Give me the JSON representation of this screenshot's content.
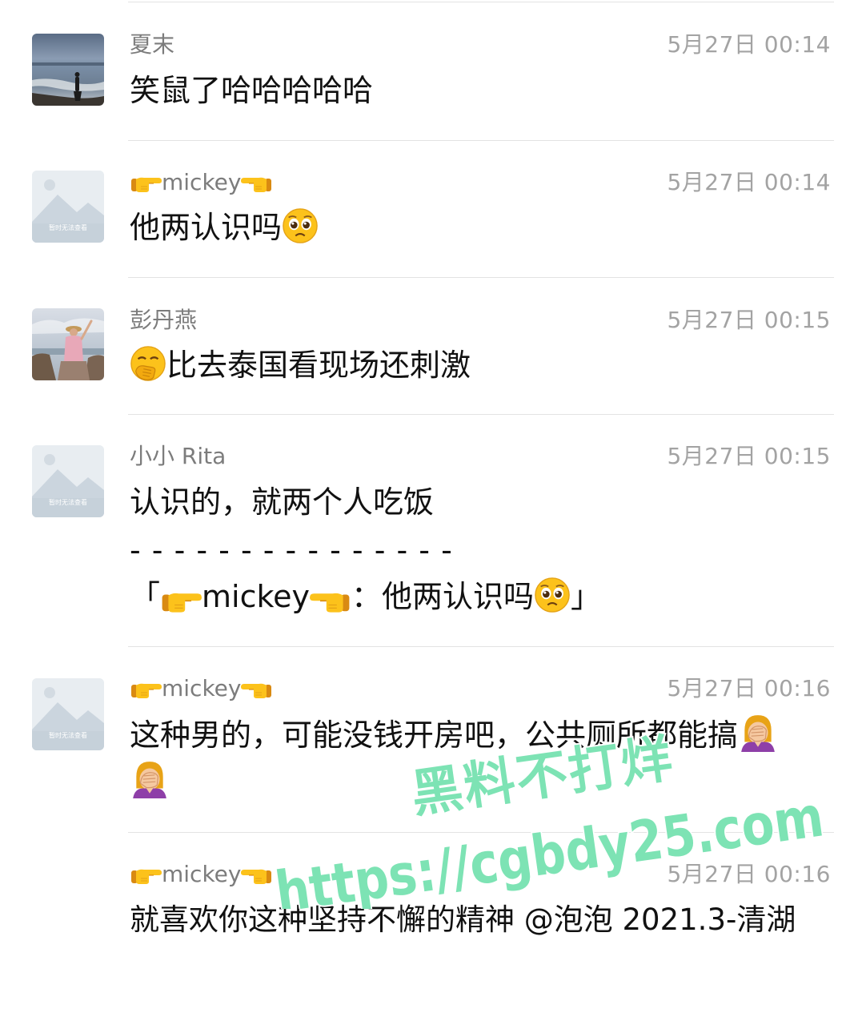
{
  "comments": [
    {
      "nickname": "夏末",
      "time": "5月27日 00:14",
      "lines": [
        "笑鼠了哈哈哈哈哈"
      ],
      "avatar": "beach-silhouette-photo"
    },
    {
      "nickname_text": "mickey",
      "time": "5月27日 00:14",
      "text": "他两认识吗",
      "avatar": "placeholder-image",
      "avatar_caption": "暂时无法查看"
    },
    {
      "nickname": "彭丹燕",
      "time": "5月27日 00:15",
      "text": "比去泰国看现场还刺激",
      "avatar": "woman-seaside-photo"
    },
    {
      "nickname": "小小 Rita",
      "time": "5月27日 00:15",
      "line1": "认识的，就两个人吃饭",
      "line2": "- - - - - - - - - - - - - - -",
      "quote_open": "「",
      "quote_name": "mickey",
      "quote_text": "：他两认识吗",
      "quote_close": "」",
      "avatar": "placeholder-image",
      "avatar_caption": "暂时无法查看"
    },
    {
      "nickname_text": "mickey",
      "time": "5月27日 00:16",
      "line1": "这种男的，可能没钱开房吧，公共厕所都能搞",
      "avatar": "placeholder-image",
      "avatar_caption": "暂时无法查看"
    },
    {
      "nickname_text": "mickey",
      "time": "5月27日 00:16",
      "line1": "就喜欢你这种坚持不懈的精神 @泡泡 2021.3-清湖"
    }
  ],
  "watermark": {
    "line1": "黑料不打烊",
    "line2": "https://cgbdy25.com"
  },
  "icons": {
    "pointing-right": "👉",
    "pointing-left": "👈",
    "pleading-face": "🥺",
    "hand-over-mouth": "🤭",
    "facepalm": "🤦"
  },
  "colors": {
    "nickname": "#7c7c7c",
    "timestamp": "#a3a3a3",
    "divider": "#e3e3e3",
    "watermark_fill": "#7de3b4",
    "watermark_stroke": "#ffffff"
  }
}
